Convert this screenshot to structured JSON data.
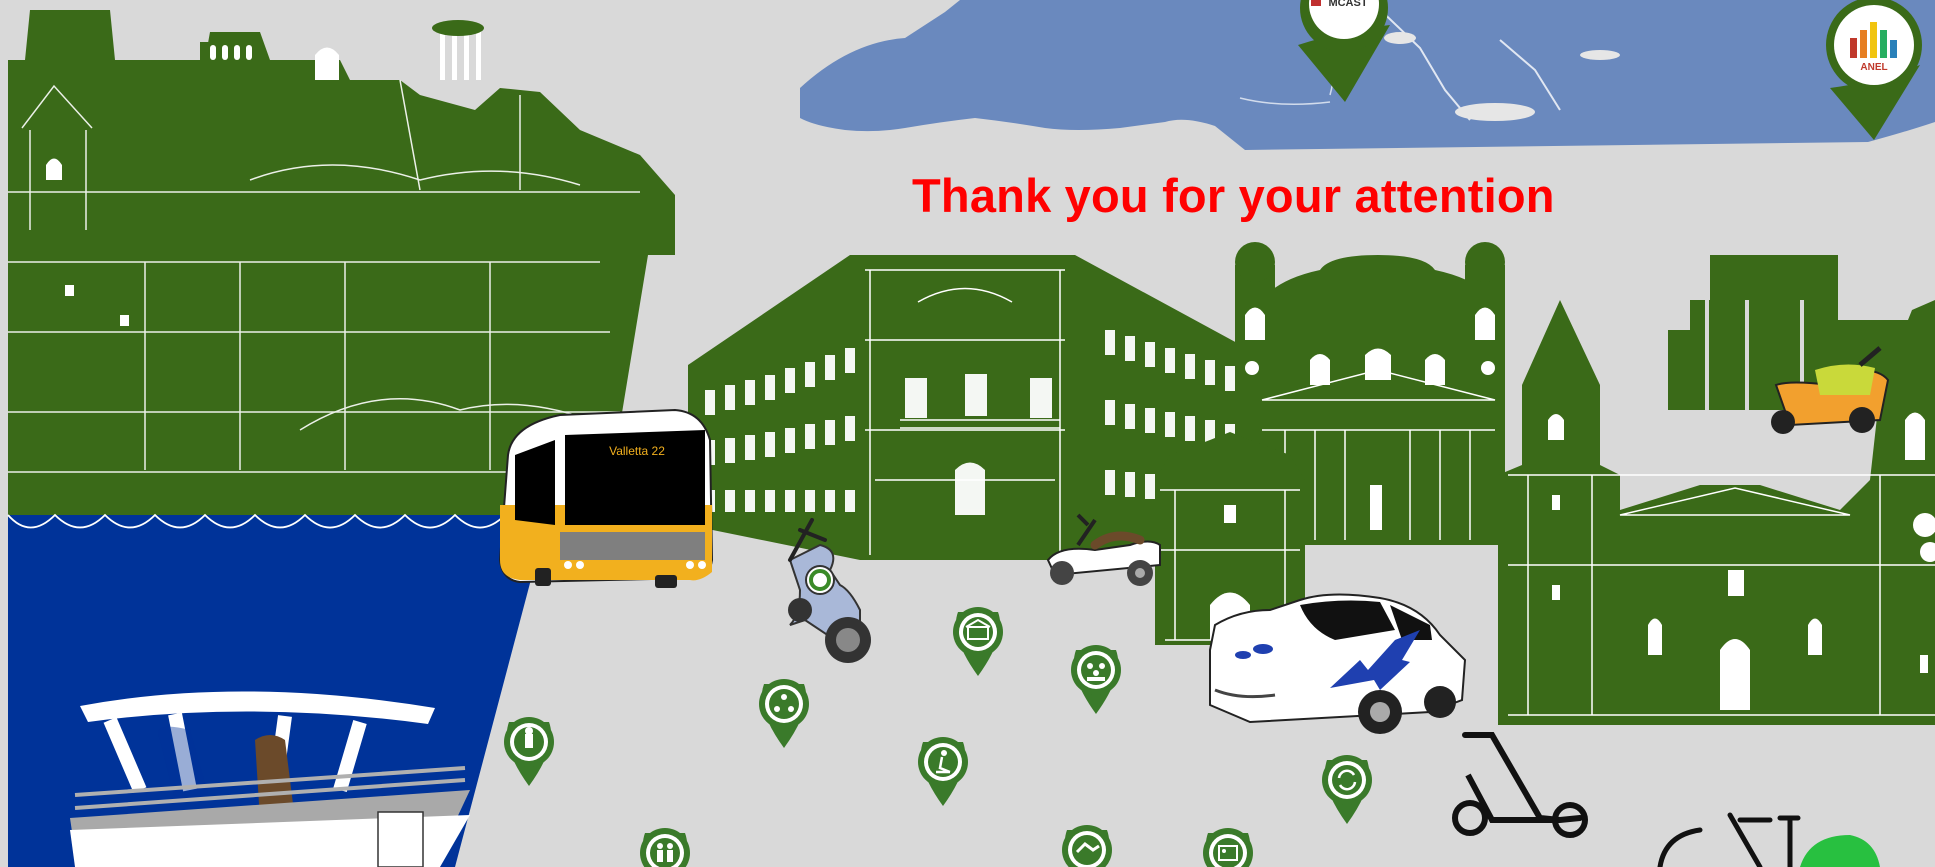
{
  "slide": {
    "title": "Thank you for your attention",
    "background_color": "#d9d9d9",
    "title_color": "#ff0000",
    "landmark_color": "#3a6a18",
    "sea_color": "#003399",
    "map_color": "#6a89be"
  },
  "bus": {
    "destination": "Valletta 22"
  },
  "logos": [
    {
      "name": "MCAST",
      "text": "MCAST"
    },
    {
      "name": "ANEL",
      "text": "ANEL"
    }
  ],
  "map_pins": [
    {
      "icon": "bus-stop-icon"
    },
    {
      "icon": "recycle-people-icon"
    },
    {
      "icon": "building-icon"
    },
    {
      "icon": "group-icon"
    },
    {
      "icon": "people-icon"
    },
    {
      "icon": "scooter-rider-icon"
    },
    {
      "icon": "handshake-icon"
    },
    {
      "icon": "id-card-icon"
    },
    {
      "icon": "refresh-icon"
    }
  ]
}
